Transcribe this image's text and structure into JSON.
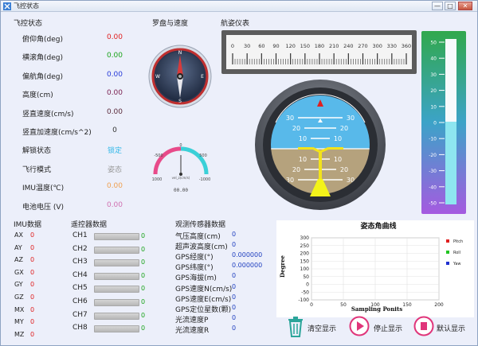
{
  "window": {
    "title": "飞控状态",
    "buttons": [
      "—",
      "□",
      "✕"
    ]
  },
  "flight": {
    "title": "飞控状态",
    "rows": [
      {
        "label": "俯仰角(deg)",
        "value": "0.00",
        "color": "#e02020"
      },
      {
        "label": "横滚角(deg)",
        "value": "0.00",
        "color": "#1aa31a"
      },
      {
        "label": "偏航角(deg)",
        "value": "0.00",
        "color": "#2438d8"
      },
      {
        "label": "高度(cm)",
        "value": "0.00",
        "color": "#7a2050"
      },
      {
        "label": "竖直速度(cm/s)",
        "value": "0.00",
        "color": "#5a2a3a"
      },
      {
        "label": "竖直加速度(cm/s^2)",
        "value": "0",
        "color": "#333333"
      },
      {
        "label": "解锁状态",
        "value": "锁定",
        "color": "#33b8e8"
      },
      {
        "label": "飞行模式",
        "value": "姿态",
        "color": "#999999"
      },
      {
        "label": "IMU温度(℃)",
        "value": "0.00",
        "color": "#f0a050"
      },
      {
        "label": "电池电压 (V)",
        "value": "0.00",
        "color": "#d070b0"
      }
    ]
  },
  "compass": {
    "title": "罗盘与速度",
    "n": "N",
    "s": "S",
    "e": "E",
    "w": "W",
    "speed_labels": [
      "0",
      "-500",
      "500",
      "1000",
      "-1000"
    ],
    "speed_unit": "vel_z(cm/s)",
    "speed_value": "00.00"
  },
  "attitude": {
    "title": "航姿仪表",
    "heading_ticks": [
      "0",
      "30",
      "60",
      "90",
      "120",
      "150",
      "180",
      "210",
      "240",
      "270",
      "300",
      "330",
      "360"
    ],
    "pitch_labels": [
      "30",
      "20",
      "10",
      "10",
      "20",
      "30"
    ],
    "vbar_ticks": [
      "50",
      "40",
      "30",
      "20",
      "10",
      "0",
      "-10",
      "-20",
      "-30",
      "-40",
      "-50"
    ],
    "vbar_level": 0.5
  },
  "imu": {
    "title": "IMU数据",
    "rows": [
      {
        "label": "AX",
        "value": "0"
      },
      {
        "label": "AY",
        "value": "0"
      },
      {
        "label": "AZ",
        "value": "0"
      },
      {
        "label": "GX",
        "value": "0"
      },
      {
        "label": "GY",
        "value": "0"
      },
      {
        "label": "GZ",
        "value": "0"
      },
      {
        "label": "MX",
        "value": "0"
      },
      {
        "label": "MY",
        "value": "0"
      },
      {
        "label": "MZ",
        "value": "0"
      }
    ]
  },
  "remote": {
    "title": "遥控器数据",
    "channels": [
      {
        "label": "CH1",
        "value": "0"
      },
      {
        "label": "CH2",
        "value": "0"
      },
      {
        "label": "CH3",
        "value": "0"
      },
      {
        "label": "CH4",
        "value": "0"
      },
      {
        "label": "CH5",
        "value": "0"
      },
      {
        "label": "CH6",
        "value": "0"
      },
      {
        "label": "CH7",
        "value": "0"
      },
      {
        "label": "CH8",
        "value": "0"
      }
    ]
  },
  "sensors": {
    "title": "观测传感器数据",
    "rows": [
      {
        "label": "气压高度(cm)",
        "value": "0"
      },
      {
        "label": "超声波高度(cm)",
        "value": "0"
      },
      {
        "label": "GPS经度(°)",
        "value": "0.000000"
      },
      {
        "label": "GPS纬度(°)",
        "value": "0.000000"
      },
      {
        "label": "GPS海拔(m)",
        "value": "0"
      },
      {
        "label": "GPS速度N(cm/s)",
        "value": "0"
      },
      {
        "label": "GPS速度E(cm/s)",
        "value": "0"
      },
      {
        "label": "GPS定位星数(颗)",
        "value": "0"
      },
      {
        "label": "光流速度P",
        "value": "0"
      },
      {
        "label": "光流速度R",
        "value": "0"
      }
    ]
  },
  "chart_data": {
    "type": "line",
    "title": "姿态角曲线",
    "xlabel": "Sampling Ponits",
    "ylabel": "Degree",
    "xlim": [
      0,
      200
    ],
    "ylim": [
      -100,
      300
    ],
    "xticks": [
      "0",
      "50",
      "100",
      "150",
      "200"
    ],
    "yticks": [
      "300",
      "250",
      "200",
      "150",
      "100",
      "50",
      "0",
      "-50",
      "-100"
    ],
    "series": [
      {
        "name": "Pitch",
        "color": "#e02020",
        "values": []
      },
      {
        "name": "Roll",
        "color": "#22c422",
        "values": []
      },
      {
        "name": "Yaw",
        "color": "#2030d0",
        "values": []
      }
    ],
    "legend": "right",
    "grid": true
  },
  "actions": {
    "clear": "清空显示",
    "stop": "停止显示",
    "default": "默认显示"
  }
}
